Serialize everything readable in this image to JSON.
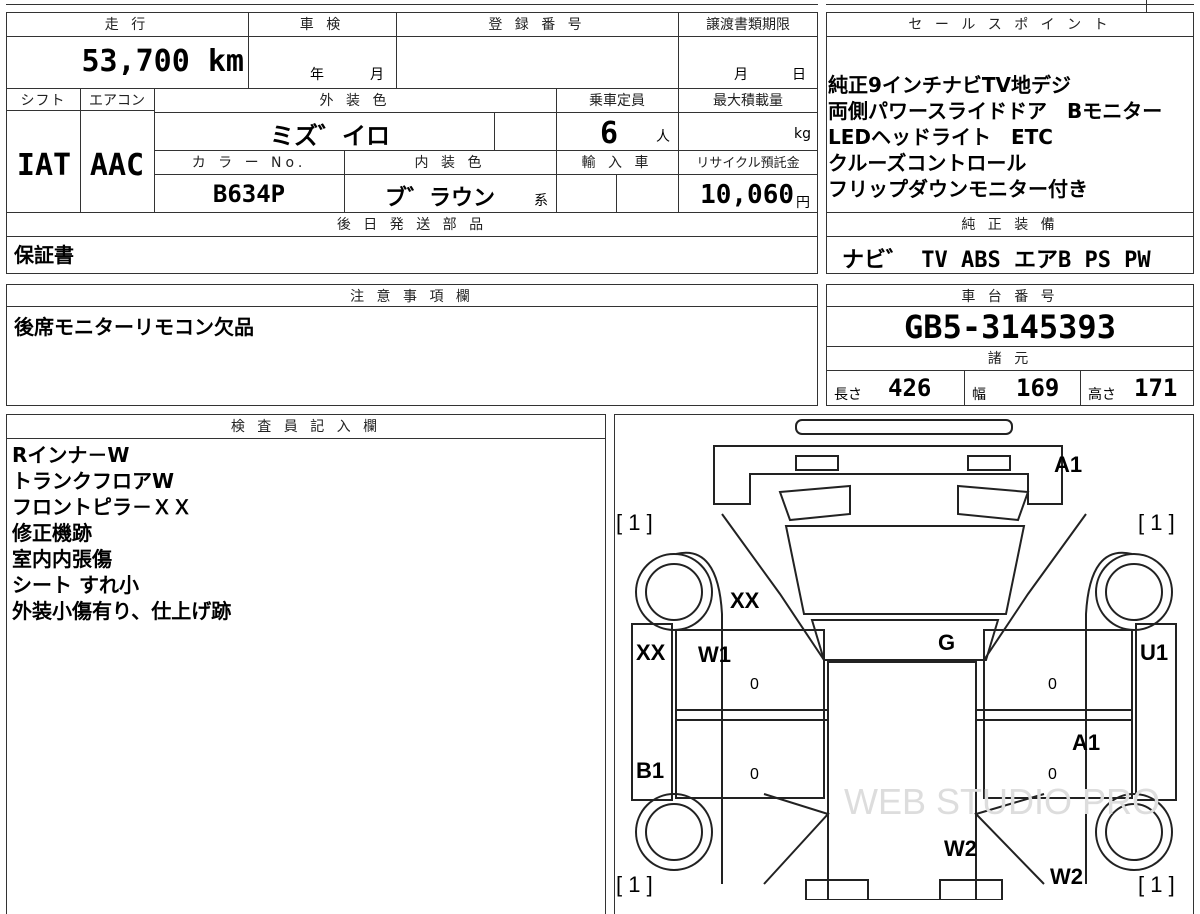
{
  "top_box": {
    "headers": {
      "mileage": "走 行",
      "inspection": "車 検",
      "registration": "登 録 番 号",
      "transfer": "譲渡書類期限"
    },
    "mileage": "53,700 km",
    "inspection_year": "年",
    "inspection_month": "月",
    "transfer_month": "月",
    "transfer_day": "日",
    "headers2": {
      "shift": "シフト",
      "aircon": "エアコン",
      "exterior_color": "外 装 色",
      "capacity": "乗車定員",
      "max_load": "最大積載量"
    },
    "shift": "IAT",
    "aircon": "AAC",
    "exterior_color": "ミズ゛イロ",
    "capacity": "6",
    "capacity_unit": "人",
    "max_load_unit": "kg",
    "headers3": {
      "color_no": "カ ラ ー No.",
      "interior_color": "内 装 色",
      "imported": "輸 入 車",
      "recycle": "リサイクル預託金"
    },
    "color_no": "B634P",
    "interior_color": "ブ゛ラウン",
    "interior_suffix": "系",
    "recycle_amount": "10,060",
    "recycle_unit": "円",
    "later_parts_header": "後 日 発 送 部 品",
    "later_parts": "保証書"
  },
  "sales_points": {
    "header": "セ ー ル ス ポ イ ン ト",
    "lines": [
      "純正9インチナビTV地デジ",
      "両側パワースライドドア　Bモニター",
      "LEDヘッドライト　ETC",
      "クルーズコントロール",
      "フリップダウンモニター付き"
    ],
    "equipment_header": "純 正 装 備",
    "equipment": "ナビ゛ TV ABS エアB PS PW"
  },
  "notes": {
    "header": "注 意 事 項 欄",
    "text": "後席モニターリモコン欠品"
  },
  "chassis": {
    "header": "車 台 番 号",
    "number": "GB5-3145393",
    "specs_header": "諸 元",
    "length_label": "長さ",
    "length": "426",
    "width_label": "幅",
    "width": "169",
    "height_label": "高さ",
    "height": "171"
  },
  "inspector": {
    "header": "検 査 員 記 入 欄",
    "lines": [
      "Rインナ－W",
      "トランクフロアW",
      "フロントピラ－ＸＸ",
      "修正機跡",
      "室内内張傷",
      "シート すれ小",
      "外装小傷有り、仕上げ跡"
    ]
  },
  "diagram": {
    "marks": {
      "front_right": "A1",
      "bracket_tl": "[ 1 ]",
      "bracket_tr": "[ 1 ]",
      "bracket_bl": "[ 1 ]",
      "bracket_br": "[ 1 ]",
      "left_pillar": "XX",
      "left_fender": "XX",
      "left_front_door": "W1",
      "roof": "G",
      "right_fender": "U1",
      "right_rear_door": "A1",
      "left_rear": "B1",
      "floor": "W2",
      "rear_right": "W2",
      "zero1": "0",
      "zero2": "0",
      "zero3": "0",
      "zero4": "0"
    },
    "watermark": "WEB STUDIO PRO"
  }
}
